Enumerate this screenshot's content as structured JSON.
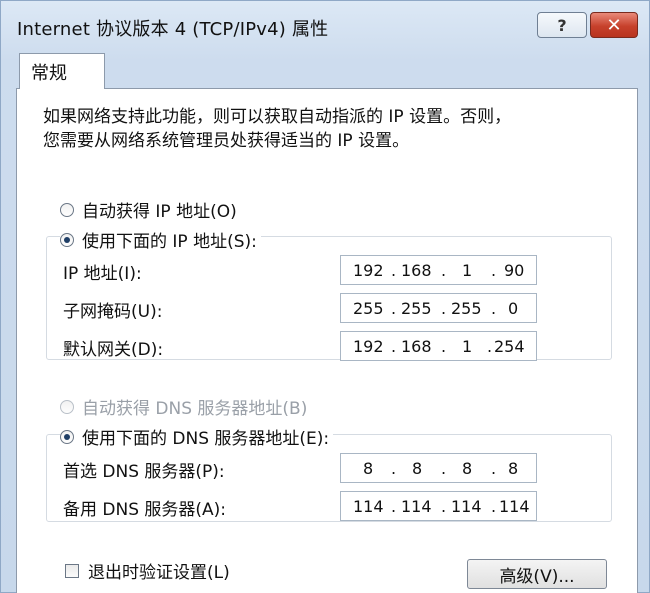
{
  "window": {
    "title": "Internet 协议版本 4 (TCP/IPv4) 属性",
    "help_label": "?",
    "close_label": "✕"
  },
  "tabs": [
    {
      "label": "常规",
      "selected": true
    }
  ],
  "description": {
    "line1": "如果网络支持此功能，则可以获取自动指派的 IP 设置。否则，",
    "line2": "您需要从网络系统管理员处获得适当的 IP 设置。"
  },
  "ip_mode": {
    "auto_label": "自动获得 IP 地址(O)",
    "manual_label": "使用下面的 IP 地址(S):",
    "selected": "manual"
  },
  "ip_fields": [
    {
      "label": "IP 地址(I):",
      "octets": [
        "192",
        "168",
        "1",
        "90"
      ]
    },
    {
      "label": "子网掩码(U):",
      "octets": [
        "255",
        "255",
        "255",
        "0"
      ]
    },
    {
      "label": "默认网关(D):",
      "octets": [
        "192",
        "168",
        "1",
        "254"
      ]
    }
  ],
  "dns_mode": {
    "auto_label": "自动获得 DNS 服务器地址(B)",
    "manual_label": "使用下面的 DNS 服务器地址(E):",
    "selected": "manual",
    "auto_disabled": true
  },
  "dns_fields": [
    {
      "label": "首选 DNS 服务器(P):",
      "octets": [
        "8",
        "8",
        "8",
        "8"
      ]
    },
    {
      "label": "备用 DNS 服务器(A):",
      "octets": [
        "114",
        "114",
        "114",
        "114"
      ]
    }
  ],
  "validate_on_exit": {
    "label": "退出时验证设置(L)",
    "checked": false
  },
  "advanced_button": "高级(V)..."
}
